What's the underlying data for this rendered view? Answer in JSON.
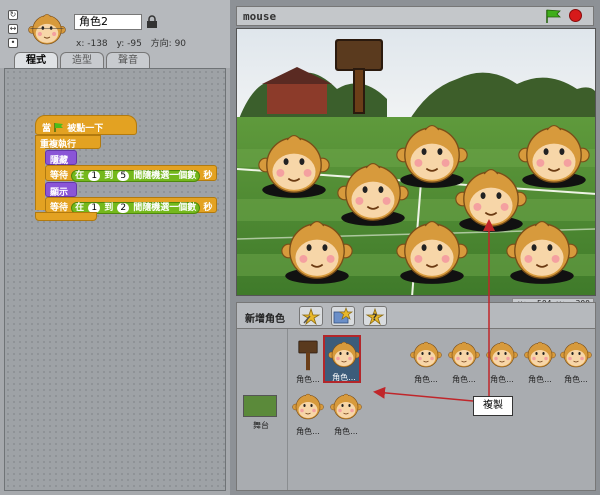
{
  "sprite": {
    "name": "角色2",
    "x_label": "x: -138",
    "y_label": "y: -95",
    "direction_label": "方向: 90"
  },
  "tabs": [
    {
      "label": "程式",
      "active": true
    },
    {
      "label": "造型",
      "active": false
    },
    {
      "label": "聲音",
      "active": false
    }
  ],
  "script": {
    "when_flag": "當",
    "when_flag_suffix": "被點一下",
    "forever": "重複執行",
    "hide": "隱藏",
    "show": "顯示",
    "wait": "等待",
    "seconds": "秒",
    "pick_random_in": "在",
    "pick_random_to": "到",
    "pick_random_suffix": "間隨機選一個數",
    "wait1_min": "1",
    "wait1_max": "5",
    "wait2_min": "1",
    "wait2_max": "2"
  },
  "stage": {
    "title": "mouse",
    "mouse_x": "x: -504",
    "mouse_y": "y: -300"
  },
  "sprite_list": {
    "new_sprite_label": "新增角色",
    "stage_label": "舞台",
    "tiles": [
      "角色...",
      "角色...",
      "角色...",
      "角色...",
      "角色...",
      "角色...",
      "角色...",
      "角色...",
      "角色..."
    ]
  },
  "annotation": {
    "copy_label": "複製"
  },
  "colors": {
    "control": "#e3a222",
    "looks": "#8a55d7",
    "operators": "#74b81c",
    "annotation_arrow": "#c0262a"
  }
}
